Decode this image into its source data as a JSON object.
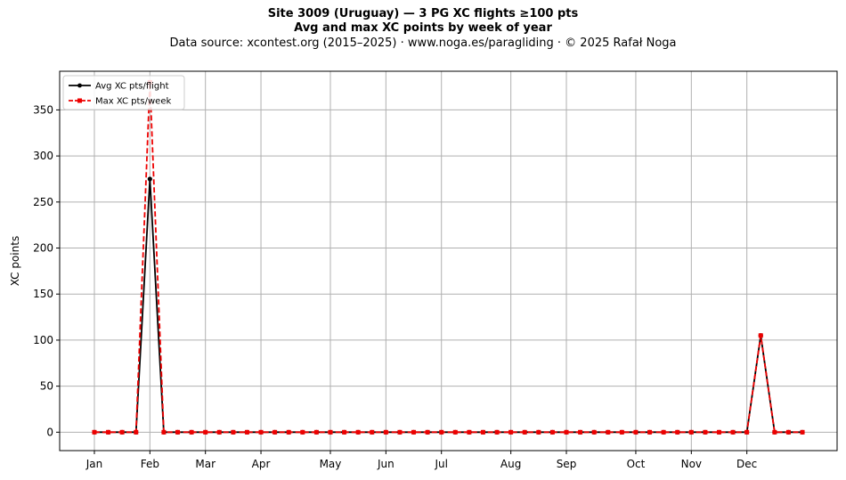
{
  "header": {
    "title": "Site 3009 (Uruguay)  —  3 PG XC flights ≥100 pts",
    "subtitle": "Avg and max XC points by week of year",
    "source": "Data source: xcontest.org (2015–2025)  ·  www.noga.es/paragliding  ·  © 2025 Rafał Noga"
  },
  "chart_data": {
    "type": "line",
    "title": "Site 3009 (Uruguay)  —  3 PG XC flights ≥100 pts",
    "subtitle": "Avg and max XC points by week of year",
    "xlabel": "",
    "ylabel": "XC points",
    "x": [
      1,
      2,
      3,
      4,
      5,
      6,
      7,
      8,
      9,
      10,
      11,
      12,
      13,
      14,
      15,
      16,
      17,
      18,
      19,
      20,
      21,
      22,
      23,
      24,
      25,
      26,
      27,
      28,
      29,
      30,
      31,
      32,
      33,
      34,
      35,
      36,
      37,
      38,
      39,
      40,
      41,
      42,
      43,
      44,
      45,
      46,
      47,
      48,
      49,
      50,
      51,
      52
    ],
    "month_ticks": [
      {
        "label": "Jan",
        "week": 1
      },
      {
        "label": "Feb",
        "week": 5
      },
      {
        "label": "Mar",
        "week": 9
      },
      {
        "label": "Apr",
        "week": 13
      },
      {
        "label": "May",
        "week": 18
      },
      {
        "label": "Jun",
        "week": 22
      },
      {
        "label": "Jul",
        "week": 26
      },
      {
        "label": "Aug",
        "week": 31
      },
      {
        "label": "Sep",
        "week": 35
      },
      {
        "label": "Oct",
        "week": 40
      },
      {
        "label": "Nov",
        "week": 44
      },
      {
        "label": "Dec",
        "week": 48
      }
    ],
    "xlim": [
      -1.5,
      54.5
    ],
    "ylim": [
      -20,
      392
    ],
    "yticks": [
      0,
      50,
      100,
      150,
      200,
      250,
      300,
      350
    ],
    "grid": true,
    "legend_position": "top-left",
    "series": [
      {
        "name": "Avg XC pts/flight",
        "color": "#000000",
        "style": "solid",
        "marker": "circle",
        "values": [
          0,
          0,
          0,
          0,
          275,
          0,
          0,
          0,
          0,
          0,
          0,
          0,
          0,
          0,
          0,
          0,
          0,
          0,
          0,
          0,
          0,
          0,
          0,
          0,
          0,
          0,
          0,
          0,
          0,
          0,
          0,
          0,
          0,
          0,
          0,
          0,
          0,
          0,
          0,
          0,
          0,
          0,
          0,
          0,
          0,
          0,
          0,
          0,
          105,
          0,
          0,
          0
        ]
      },
      {
        "name": "Max XC pts/week",
        "color": "#ee0000",
        "style": "dashed",
        "marker": "square",
        "values": [
          0,
          0,
          0,
          0,
          380,
          0,
          0,
          0,
          0,
          0,
          0,
          0,
          0,
          0,
          0,
          0,
          0,
          0,
          0,
          0,
          0,
          0,
          0,
          0,
          0,
          0,
          0,
          0,
          0,
          0,
          0,
          0,
          0,
          0,
          0,
          0,
          0,
          0,
          0,
          0,
          0,
          0,
          0,
          0,
          0,
          0,
          0,
          0,
          105,
          0,
          0,
          0
        ]
      }
    ]
  }
}
